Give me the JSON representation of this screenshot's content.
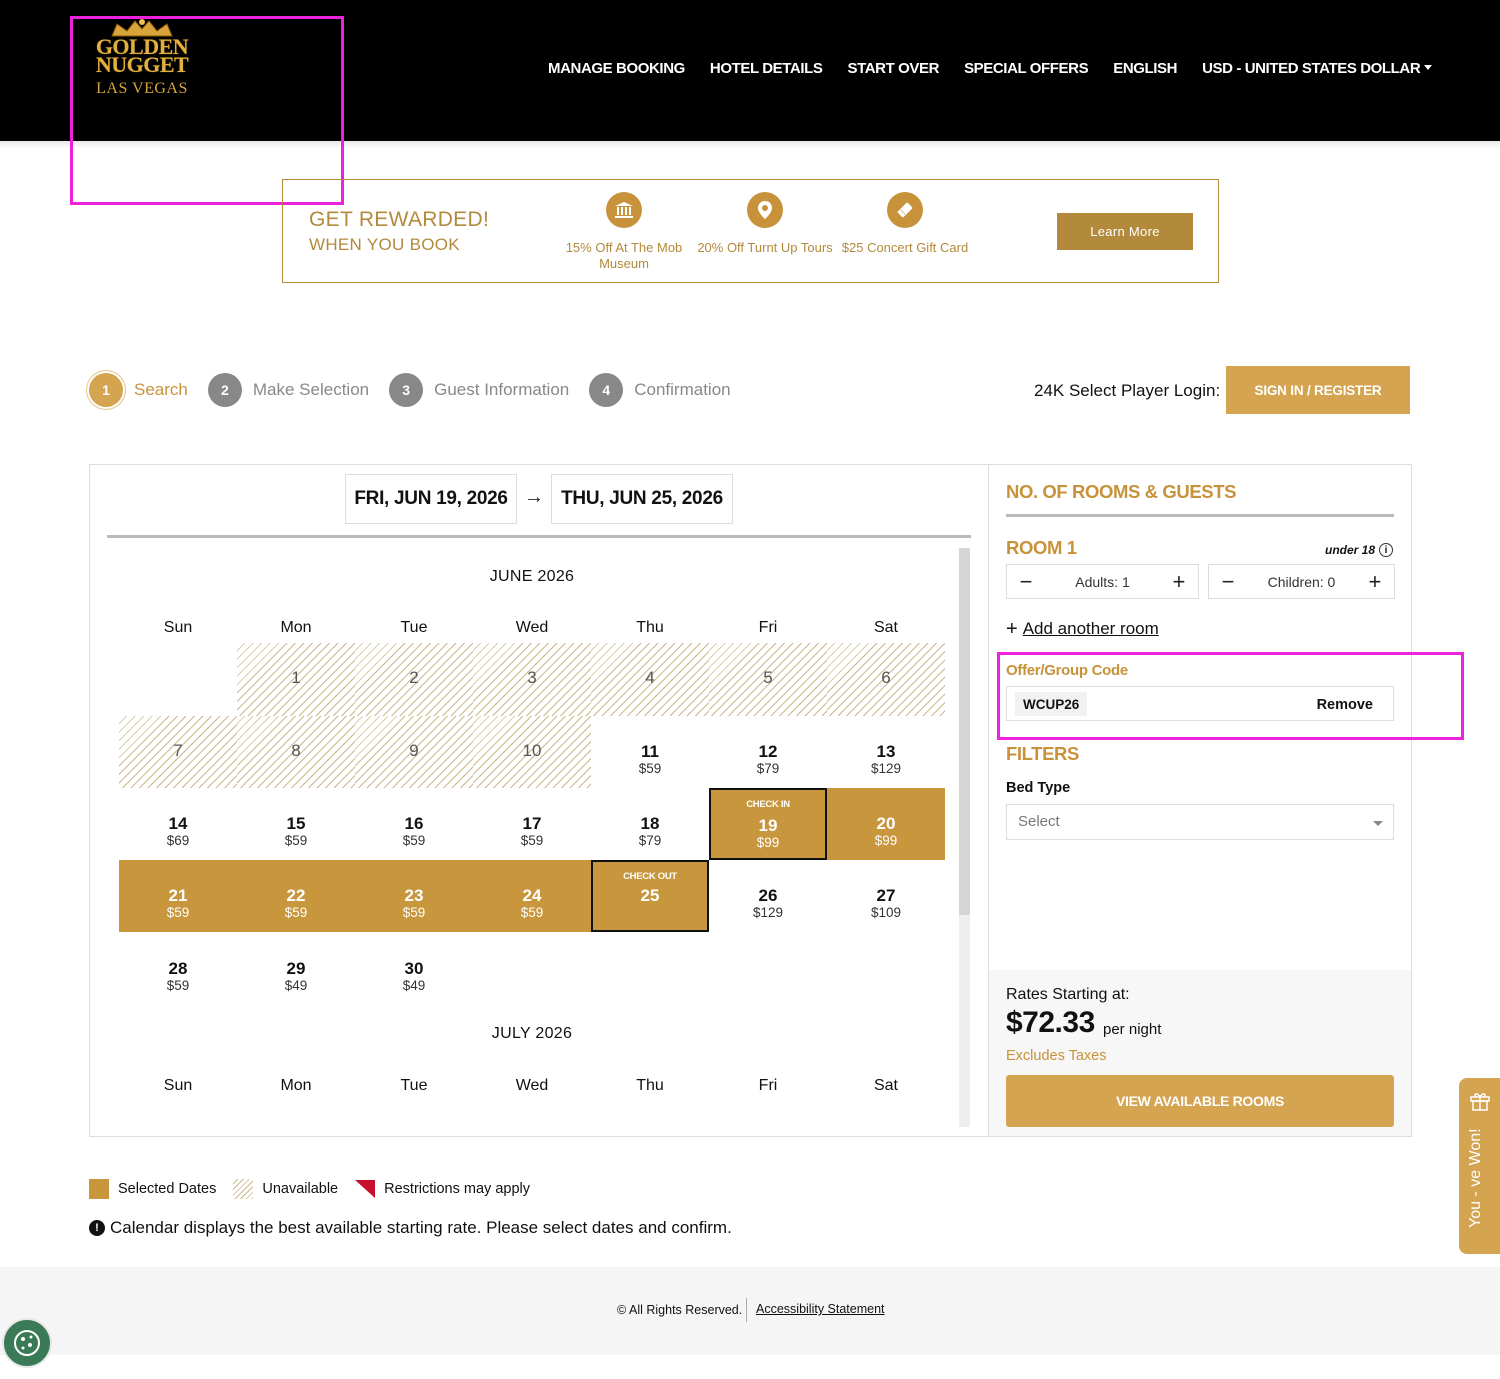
{
  "brand": {
    "logo_line1": "GOLDEN",
    "logo_line2": "NUGGET",
    "logo_line3": "LAS VEGAS"
  },
  "nav": {
    "items": [
      "MANAGE BOOKING",
      "HOTEL DETAILS",
      "START OVER",
      "SPECIAL OFFERS",
      "ENGLISH",
      "USD - UNITED STATES DOLLAR"
    ]
  },
  "rewards": {
    "title1": "GET REWARDED!",
    "title2": "WHEN YOU BOOK",
    "perks": [
      {
        "icon": "museum-icon",
        "label": "15% Off At The Mob Museum"
      },
      {
        "icon": "location-pin-icon",
        "label": "20% Off Turnt Up Tours"
      },
      {
        "icon": "gift-card-icon",
        "label": "$25 Concert Gift Card"
      }
    ],
    "cta": "Learn More"
  },
  "steps": [
    {
      "num": "1",
      "label": "Search",
      "active": true
    },
    {
      "num": "2",
      "label": "Make Selection",
      "active": false
    },
    {
      "num": "3",
      "label": "Guest Information",
      "active": false
    },
    {
      "num": "4",
      "label": "Confirmation",
      "active": false
    }
  ],
  "login": {
    "label": "24K Select Player Login:",
    "button": "SIGN IN / REGISTER"
  },
  "dates": {
    "checkin": "FRI, JUN 19, 2026",
    "arrow": "→",
    "checkout": "THU, JUN 25, 2026"
  },
  "calendar": {
    "days_of_week": [
      "Sun",
      "Mon",
      "Tue",
      "Wed",
      "Thu",
      "Fri",
      "Sat"
    ],
    "june": {
      "title": "JUNE 2026",
      "weeks": [
        [
          null,
          {
            "d": "1",
            "s": "un"
          },
          {
            "d": "2",
            "s": "un"
          },
          {
            "d": "3",
            "s": "un"
          },
          {
            "d": "4",
            "s": "un"
          },
          {
            "d": "5",
            "s": "un"
          },
          {
            "d": "6",
            "s": "un"
          }
        ],
        [
          {
            "d": "7",
            "s": "un"
          },
          {
            "d": "8",
            "s": "un"
          },
          {
            "d": "9",
            "s": "un"
          },
          {
            "d": "10",
            "s": "un"
          },
          {
            "d": "11",
            "p": "$59",
            "s": "av"
          },
          {
            "d": "12",
            "p": "$79",
            "s": "av"
          },
          {
            "d": "13",
            "p": "$129",
            "s": "av"
          }
        ],
        [
          {
            "d": "14",
            "p": "$69",
            "s": "av"
          },
          {
            "d": "15",
            "p": "$59",
            "s": "av"
          },
          {
            "d": "16",
            "p": "$59",
            "s": "av"
          },
          {
            "d": "17",
            "p": "$59",
            "s": "av"
          },
          {
            "d": "18",
            "p": "$79",
            "s": "av"
          },
          {
            "d": "19",
            "p": "$99",
            "s": "sel",
            "tag": "CHECK IN"
          },
          {
            "d": "20",
            "p": "$99",
            "s": "sel"
          }
        ],
        [
          {
            "d": "21",
            "p": "$59",
            "s": "sel"
          },
          {
            "d": "22",
            "p": "$59",
            "s": "sel"
          },
          {
            "d": "23",
            "p": "$59",
            "s": "sel"
          },
          {
            "d": "24",
            "p": "$59",
            "s": "sel"
          },
          {
            "d": "25",
            "s": "sel",
            "tag": "CHECK OUT"
          },
          {
            "d": "26",
            "p": "$129",
            "s": "av"
          },
          {
            "d": "27",
            "p": "$109",
            "s": "av"
          }
        ],
        [
          {
            "d": "28",
            "p": "$59",
            "s": "av"
          },
          {
            "d": "29",
            "p": "$49",
            "s": "av"
          },
          {
            "d": "30",
            "p": "$49",
            "s": "av"
          },
          null,
          null,
          null,
          null
        ]
      ]
    },
    "july": {
      "title": "JULY 2026"
    }
  },
  "rooms": {
    "title": "NO. OF ROOMS & GUESTS",
    "room_label": "ROOM 1",
    "under_label": "under 18",
    "adults": "Adults: 1",
    "children": "Children: 0",
    "add_room": "Add another room",
    "offer_label": "Offer/Group Code",
    "offer_code": "WCUP26",
    "remove": "Remove",
    "filters": "FILTERS",
    "bed_type_label": "Bed Type",
    "bed_type_value": "Select",
    "rates_label": "Rates Starting at:",
    "price": "$72.33",
    "per_night": "per night",
    "excludes": "Excludes Taxes",
    "view_button": "VIEW AVAILABLE ROOMS"
  },
  "legend": {
    "selected": "Selected Dates",
    "unavailable": "Unavailable",
    "restrictions": "Restrictions may apply",
    "note": "Calendar displays the best available starting rate. Please select dates and confirm."
  },
  "footer": {
    "copyright": "© All Rights Reserved.",
    "accessibility": "Accessibility Statement"
  },
  "widget": {
    "won": "You - ve Won!"
  },
  "colors": {
    "gold": "#c8963c",
    "gold_light": "#d4a451",
    "header_bg": "#000000",
    "annotation_magenta": "#ee22dd"
  }
}
